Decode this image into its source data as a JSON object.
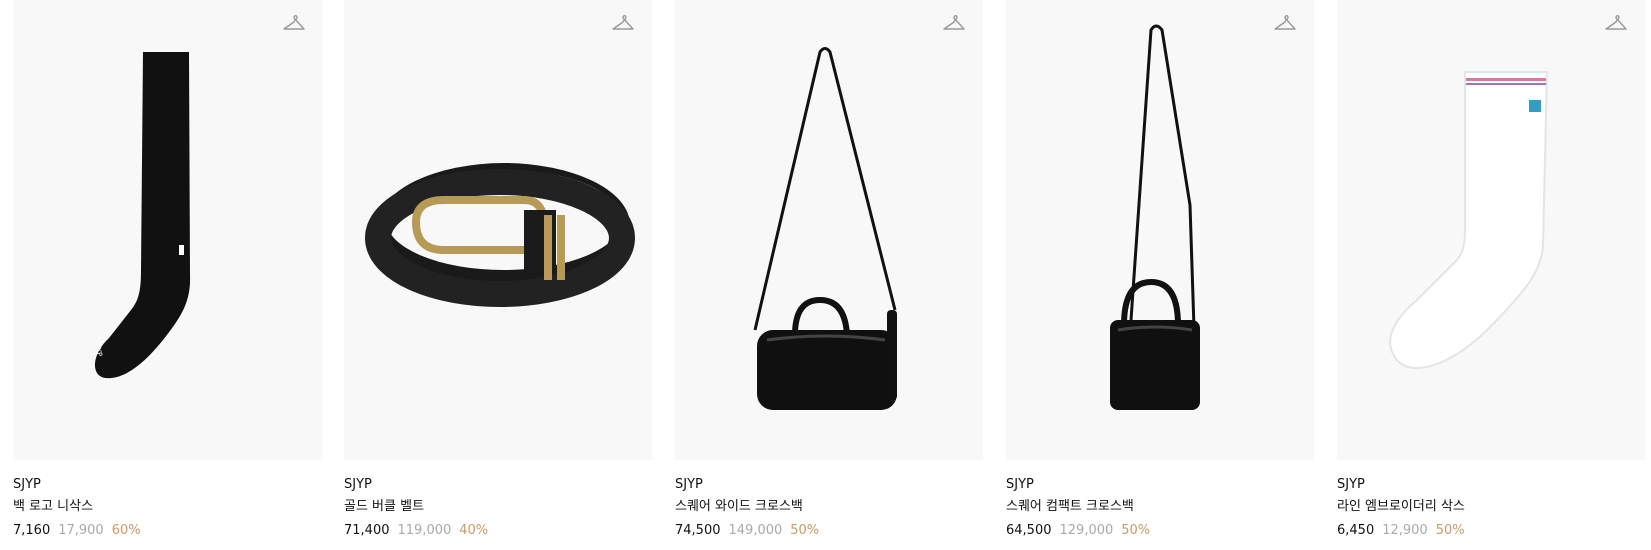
{
  "products": [
    {
      "brand": "SJYP",
      "name": "백 로고 니삭스",
      "price": "7,160",
      "original_price": "17,900",
      "discount": "60%",
      "art": "knee-sock"
    },
    {
      "brand": "SJYP",
      "name": "골드 버클 벨트",
      "price": "71,400",
      "original_price": "119,000",
      "discount": "40%",
      "art": "belt"
    },
    {
      "brand": "SJYP",
      "name": "스퀘어 와이드 크로스백",
      "price": "74,500",
      "original_price": "149,000",
      "discount": "50%",
      "art": "wide-bag"
    },
    {
      "brand": "SJYP",
      "name": "스퀘어 컴팩트 크로스백",
      "price": "64,500",
      "original_price": "129,000",
      "discount": "50%",
      "art": "compact-bag"
    },
    {
      "brand": "SJYP",
      "name": "라인 엠브로이더리 삭스",
      "price": "6,450",
      "original_price": "12,900",
      "discount": "50%",
      "art": "white-sock"
    }
  ],
  "icons": {
    "wishlist": "hanger-icon"
  },
  "colors": {
    "discount": "#c79a6b",
    "original_price": "#a9a9a9",
    "image_background": "#f8f8f8"
  }
}
